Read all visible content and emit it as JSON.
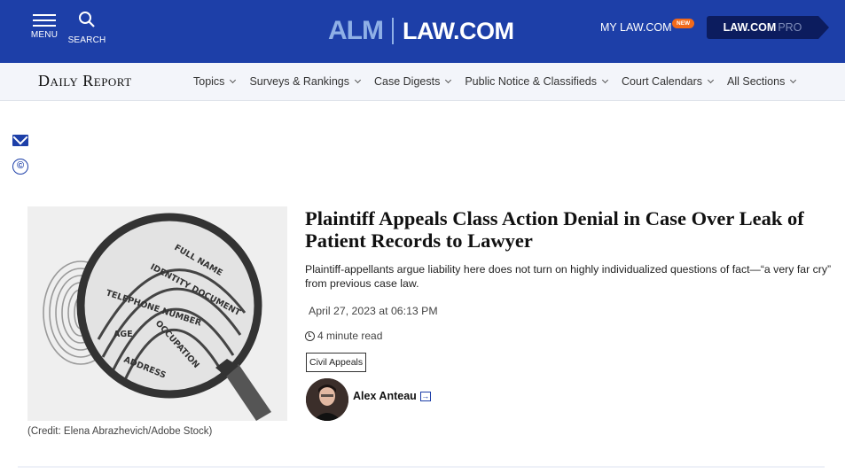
{
  "header": {
    "menu_label": "MENU",
    "search_label": "SEARCH",
    "brand_alm": "ALM",
    "brand_law": "LAW.COM",
    "my_law": "MY LAW.COM",
    "new_badge": "NEW",
    "pro_main": "LAW.COM",
    "pro_suffix": "PRO"
  },
  "nav": {
    "logo": "Daily Report",
    "items": [
      {
        "label": "Topics"
      },
      {
        "label": "Surveys & Rankings"
      },
      {
        "label": "Case Digests"
      },
      {
        "label": "Public Notice & Classifieds"
      },
      {
        "label": "Court Calendars"
      },
      {
        "label": "All Sections"
      }
    ]
  },
  "article": {
    "title": "Plaintiff Appeals Class Action Denial in Case Over Leak of Patient Records to Lawyer",
    "summary": "Plaintiff-appellants argue liability here does not turn on highly individualized questions of fact—“a very far cry” from previous case law.",
    "date": "April 27, 2023 at 06:13 PM",
    "read_time": "4 minute read",
    "tag": "Civil Appeals",
    "author": "Alex Anteau",
    "image_credit": "(Credit: Elena Abrazhevich/Adobe Stock)",
    "image_words": [
      "FULL NAME",
      "IDENTITY DOCUMENT",
      "TELEPHONE NUMBER",
      "AGE",
      "OCCUPATION",
      "ADDRESS"
    ]
  },
  "colors": {
    "topbar": "#1d3fa8",
    "pro_bg": "#0c1c5e",
    "new_badge": "#f26a1b"
  }
}
